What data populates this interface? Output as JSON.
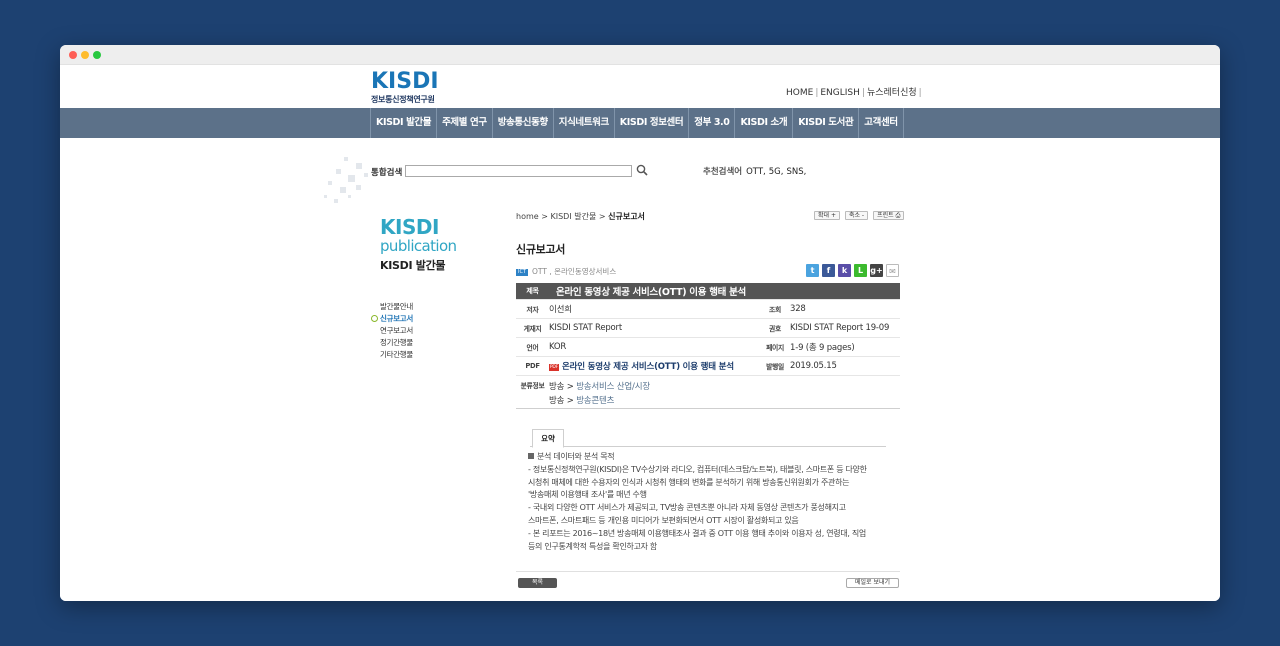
{
  "logo": {
    "text": "KISDI",
    "subtitle": "정보통신정책연구원"
  },
  "toplinks": [
    "HOME",
    "ENGLISH",
    "뉴스레터신청"
  ],
  "gnb": [
    "KISDI 발간물",
    "주제별 연구",
    "방송통신동향",
    "지식네트워크",
    "KISDI 정보센터",
    "정부 3.0",
    "KISDI 소개",
    "KISDI 도서관",
    "고객센터"
  ],
  "search": {
    "label": "통합검색",
    "value": "",
    "rec_label": "추천검색어",
    "keywords": [
      "OTT,",
      "5G,",
      "SNS,"
    ]
  },
  "sidebar": {
    "title1": "KISDI",
    "title2": "publication",
    "title3": "KISDI 발간물",
    "items": [
      "발간물안내",
      "신규보고서",
      "연구보고서",
      "정기간행물",
      "기타간행물"
    ]
  },
  "breadcrumb": {
    "home": "home",
    "sep1": " > ",
    "level1": "KISDI 발간물",
    "sep2": " > ",
    "current": "신규보고서"
  },
  "util": {
    "zoom_in": "확대 +",
    "zoom_out": "축소 -",
    "print": "프린트 ⎙"
  },
  "page_title": "신규보고서",
  "category": {
    "badge": "ICT",
    "text": "OTT , 온라인동영상서비스"
  },
  "share": {
    "twitter": "t",
    "facebook": "f",
    "kakao": "k",
    "line": "L",
    "google": "g+",
    "email": "✉"
  },
  "report": {
    "title_label": "제목",
    "title": "온라인 동영상 제공 서비스(OTT) 이용 행태 분석",
    "author_label": "저자",
    "author": "이선희",
    "views_label": "조회",
    "views": "328",
    "pub_label": "게재지",
    "pub": "KISDI STAT Report",
    "issue_label": "권호",
    "issue": "KISDI STAT Report 19-09",
    "lang_label": "언어",
    "lang": "KOR",
    "pages_label": "페이지",
    "pages": "1-9 (총 9 pages)",
    "pdf_label": "PDF",
    "pdf_icon": "PDF",
    "pdf": "온라인 동영상 제공 서비스(OTT) 이용 행태 분석",
    "date_label": "발행일",
    "date": "2019.05.15",
    "class_label": "분류정보",
    "class1_a": "방송",
    "class1_sep": " > ",
    "class1_b": "방송서비스 산업/시장",
    "class2_a": "방송",
    "class2_sep": " > ",
    "class2_b": "방송콘텐츠"
  },
  "tab_label": "요약",
  "summary": [
    "분석 데이터와 분석 목적",
    "- 정보통신정책연구원(KISDI)은 TV수상기와 라디오, 컴퓨터(데스크탑/노트북), 태블릿, 스마트폰 등 다양한",
    "시청취 매체에 대한 수용자의 인식과 시청취 행태의 변화를 분석하기 위해 방송통신위원회가 주관하는",
    "'방송매체 이용행태 조사'를 매년 수행",
    "- 국내외 다양한 OTT 서비스가 제공되고, TV방송 콘텐츠뿐 아니라 자체 동영상 콘텐츠가 풍성해지고",
    "스마트폰, 스마트패드 등 개인용 미디어가 보편화되면서 OTT 시장이 활성화되고 있음",
    "- 본 리포트는 2016~18년 방송매체 이용행태조사 결과 중 OTT 이용 행태 추이와 이용자 성, 연령대, 직업",
    "등의 인구통계학적 특성을 확인하고자 함"
  ],
  "buttons": {
    "list": "목록",
    "mail": "메일로 보내기"
  }
}
